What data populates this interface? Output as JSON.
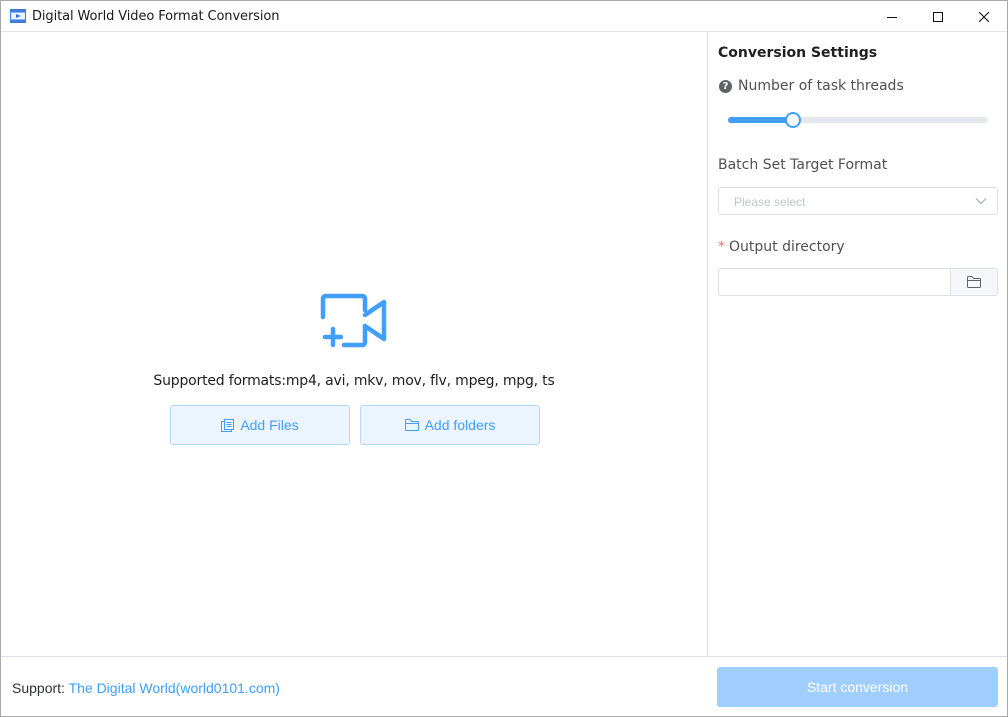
{
  "window": {
    "title": "Digital World Video Format Conversion",
    "icon": "video-app-icon",
    "controls": [
      "minimize-icon",
      "maximize-icon",
      "close-icon"
    ]
  },
  "upload": {
    "icon": "add-video-icon",
    "formats_text": "Supported formats:mp4, avi, mkv, mov, flv, mpeg, mpg, ts",
    "add_files_label": "Add Files",
    "add_files_icon": "files-icon",
    "add_folders_label": "Add folders",
    "add_folders_icon": "folder-icon"
  },
  "settings": {
    "title": "Conversion Settings",
    "threads_label": "Number of task threads",
    "threads_help_icon": "question-circle-icon",
    "threads_value_fraction": 0.25,
    "batch_format_label": "Batch Set Target Format",
    "batch_format_placeholder": "Please select",
    "output_required_mark": "*",
    "output_label": "Output directory",
    "output_value": "",
    "output_browse_icon": "folder-open-icon"
  },
  "footer": {
    "support_label": "Support: ",
    "support_link": "The Digital World(world0101.com)",
    "start_button": "Start conversion"
  },
  "colors": {
    "accent": "#409eff",
    "accent_light_bg": "#ecf5ff",
    "accent_border": "#b3d8ff",
    "disabled_primary": "#a0cfff",
    "required": "#f56c6c"
  }
}
